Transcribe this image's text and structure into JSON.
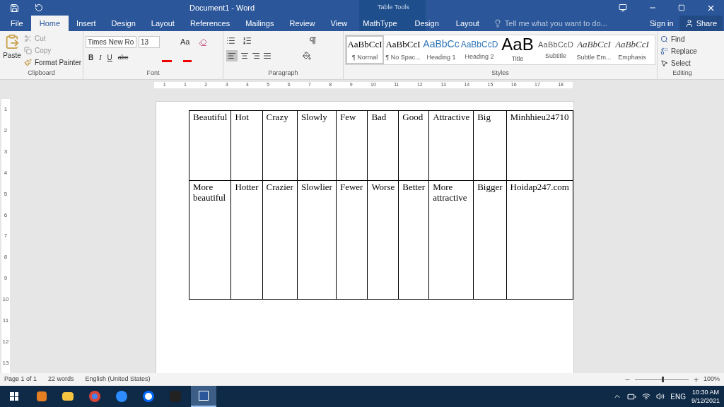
{
  "window": {
    "title": "Document1 - Word",
    "context_group": "Table Tools"
  },
  "tabs": [
    {
      "label": "File",
      "selected": false
    },
    {
      "label": "Home",
      "selected": true
    },
    {
      "label": "Insert",
      "selected": false
    },
    {
      "label": "Design",
      "selected": false
    },
    {
      "label": "Layout",
      "selected": false
    },
    {
      "label": "References",
      "selected": false
    },
    {
      "label": "Mailings",
      "selected": false
    },
    {
      "label": "Review",
      "selected": false
    },
    {
      "label": "View",
      "selected": false
    },
    {
      "label": "MathType",
      "selected": false
    }
  ],
  "context_tabs": [
    {
      "label": "Design",
      "selected": false
    },
    {
      "label": "Layout",
      "selected": false
    }
  ],
  "tell_me": {
    "placeholder": "Tell me what you want to do..."
  },
  "account": {
    "sign_in": "Sign in",
    "share": "Share"
  },
  "clipboard": {
    "paste": "Paste",
    "cut": "Cut",
    "copy": "Copy",
    "format_painter": "Format Painter",
    "label": "Clipboard"
  },
  "font": {
    "name": "Times New Ro",
    "size": "13",
    "change_case": "Aa",
    "bold": "B",
    "italic": "I",
    "underline": "U",
    "strike": "abc",
    "label": "Font"
  },
  "paragraph": {
    "label": "Paragraph"
  },
  "styles": {
    "label": "Styles",
    "items": [
      {
        "preview": "AaBbCcI",
        "name": "¶ Normal",
        "kind": "normal",
        "selected": true
      },
      {
        "preview": "AaBbCcI",
        "name": "¶ No Spac...",
        "kind": "normal",
        "selected": false
      },
      {
        "preview": "AaBbCc",
        "name": "Heading 1",
        "kind": "heading1",
        "selected": false
      },
      {
        "preview": "AaBbCcD",
        "name": "Heading 2",
        "kind": "heading2",
        "selected": false
      },
      {
        "preview": "AaB",
        "name": "Title",
        "kind": "title",
        "selected": false
      },
      {
        "preview": "AaBbCcD",
        "name": "Subtitle",
        "kind": "subtitle",
        "selected": false
      },
      {
        "preview": "AaBbCcI",
        "name": "Subtle Em...",
        "kind": "italic",
        "selected": false
      },
      {
        "preview": "AaBbCcI",
        "name": "Emphasis",
        "kind": "italic",
        "selected": false
      }
    ]
  },
  "editing": {
    "find": "Find",
    "replace": "Replace",
    "select": "Select",
    "label": "Editing"
  },
  "ruler": [
    "1",
    "1",
    "2",
    "3",
    "4",
    "5",
    "6",
    "7",
    "8",
    "9",
    "10",
    "11",
    "12",
    "13",
    "14",
    "15",
    "16",
    "17",
    "18"
  ],
  "vertical_ruler": [
    "1",
    "2",
    "3",
    "4",
    "5",
    "6",
    "7",
    "8",
    "9",
    "10",
    "11",
    "12",
    "13"
  ],
  "table": {
    "rows": [
      [
        "Beautiful",
        "Hot",
        "Crazy",
        "Slowly",
        "Few",
        "Bad",
        "Good",
        "Attractive",
        "Big",
        "Minhhieu24710"
      ],
      [
        "More beautiful",
        "Hotter",
        "Crazier",
        "Slowlier",
        "Fewer",
        "Worse",
        "Better",
        "More attractive",
        "Bigger",
        "Hoidap247.com"
      ]
    ]
  },
  "status_bar": {
    "page": "Page 1 of 1",
    "words": "22 words",
    "language": "English (United States)",
    "zoom": "100%",
    "zoom_slider": {
      "level": 0.5
    }
  },
  "taskbar": {
    "language": "ENG",
    "time": "10:30 AM",
    "date": "9/12/2021"
  }
}
